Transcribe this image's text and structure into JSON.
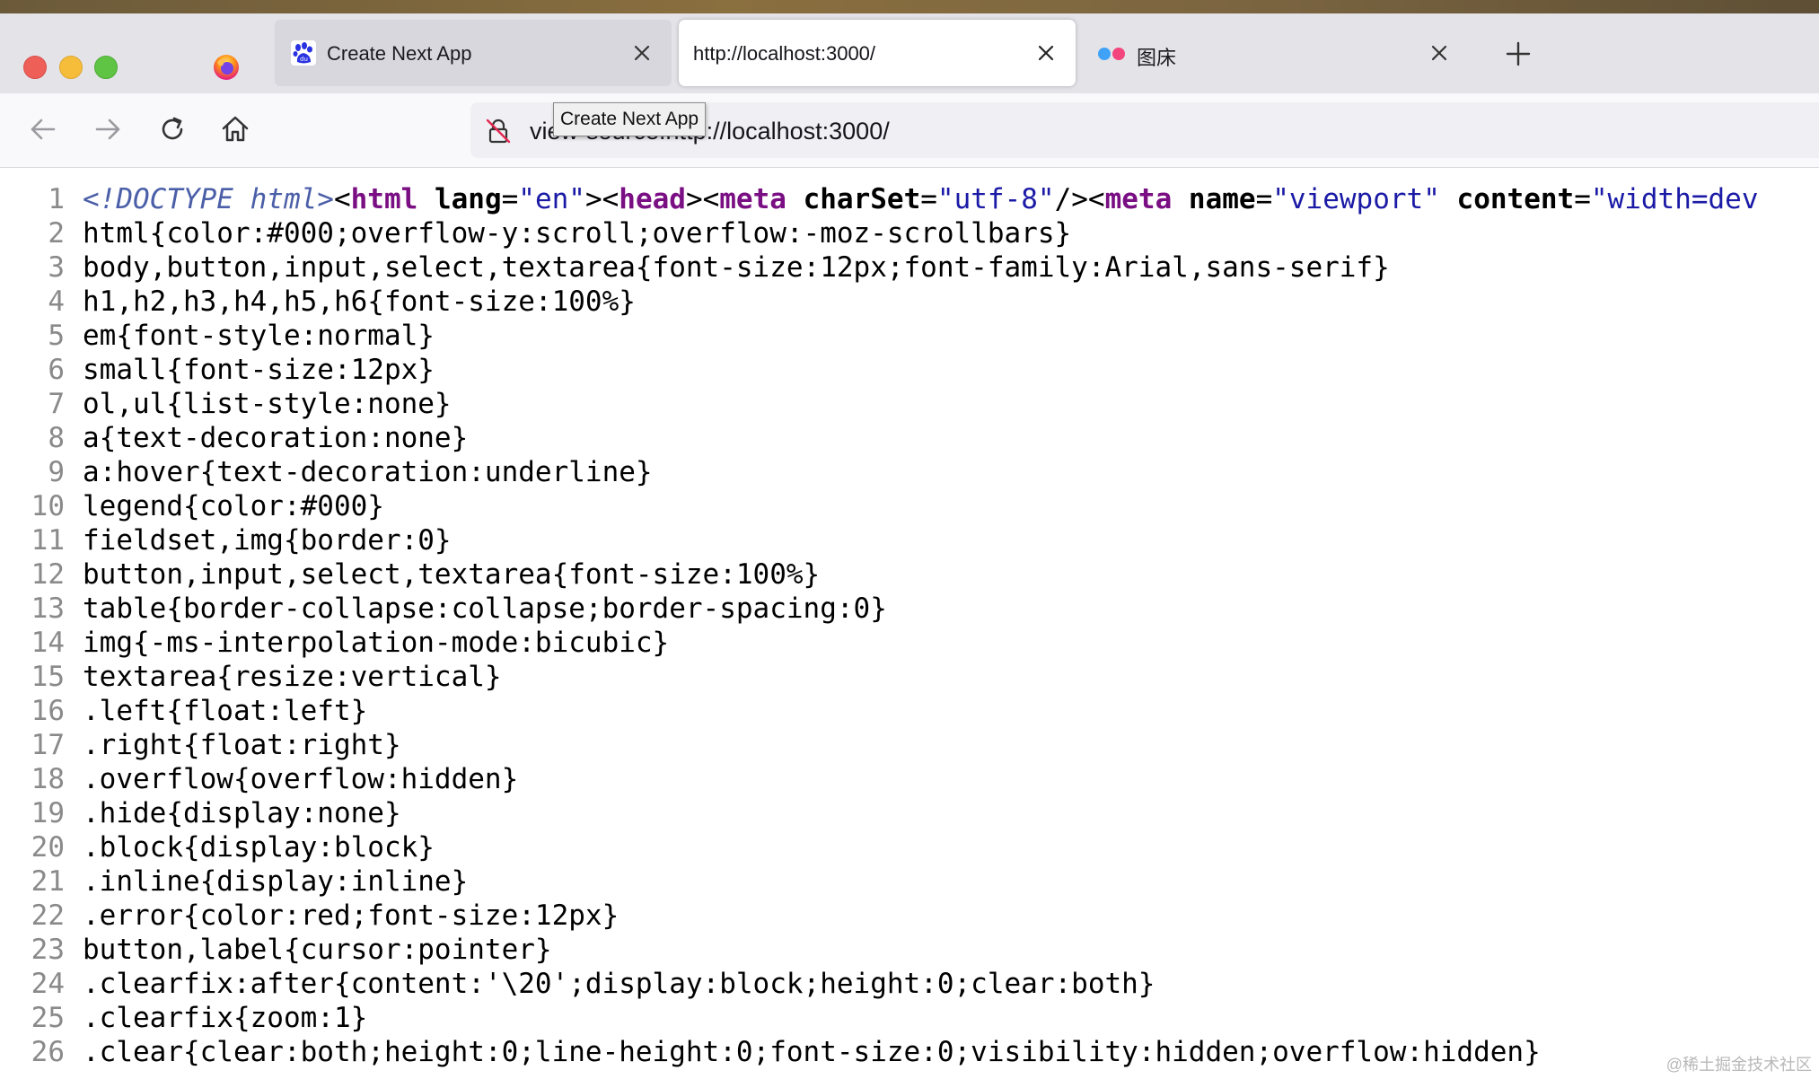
{
  "tabs": [
    {
      "title": "Create Next App",
      "favicon": "baidu-paw-icon",
      "active": false
    },
    {
      "title": "http://localhost:3000/",
      "favicon": "",
      "active": true
    },
    {
      "title": "图床",
      "favicon": "flickr-dots-icon",
      "active": false
    }
  ],
  "toolbar": {
    "url": "view-source:http://localhost:3000/",
    "tooltip": "Create Next App"
  },
  "source": {
    "line1": {
      "num": "1",
      "doctype": "<!DOCTYPE html>",
      "a": "<",
      "t1": "html",
      "a1": "lang",
      "v1": "\"en\"",
      "c1": "><",
      "t2": "head",
      "c2": "><",
      "t3": "meta",
      "a3": "charSet",
      "v3": "\"utf-8\"",
      "c3": "/><",
      "t4": "meta",
      "a4": "name",
      "v4": "\"viewport\"",
      "a5": "content",
      "v5": "\"width=dev"
    },
    "lines": [
      {
        "num": "2",
        "text": "html{color:#000;overflow-y:scroll;overflow:-moz-scrollbars}"
      },
      {
        "num": "3",
        "text": "body,button,input,select,textarea{font-size:12px;font-family:Arial,sans-serif}"
      },
      {
        "num": "4",
        "text": "h1,h2,h3,h4,h5,h6{font-size:100%}"
      },
      {
        "num": "5",
        "text": "em{font-style:normal}"
      },
      {
        "num": "6",
        "text": "small{font-size:12px}"
      },
      {
        "num": "7",
        "text": "ol,ul{list-style:none}"
      },
      {
        "num": "8",
        "text": "a{text-decoration:none}"
      },
      {
        "num": "9",
        "text": "a:hover{text-decoration:underline}"
      },
      {
        "num": "10",
        "text": "legend{color:#000}"
      },
      {
        "num": "11",
        "text": "fieldset,img{border:0}"
      },
      {
        "num": "12",
        "text": "button,input,select,textarea{font-size:100%}"
      },
      {
        "num": "13",
        "text": "table{border-collapse:collapse;border-spacing:0}"
      },
      {
        "num": "14",
        "text": "img{-ms-interpolation-mode:bicubic}"
      },
      {
        "num": "15",
        "text": "textarea{resize:vertical}"
      },
      {
        "num": "16",
        "text": ".left{float:left}"
      },
      {
        "num": "17",
        "text": ".right{float:right}"
      },
      {
        "num": "18",
        "text": ".overflow{overflow:hidden}"
      },
      {
        "num": "19",
        "text": ".hide{display:none}"
      },
      {
        "num": "20",
        "text": ".block{display:block}"
      },
      {
        "num": "21",
        "text": ".inline{display:inline}"
      },
      {
        "num": "22",
        "text": ".error{color:red;font-size:12px}"
      },
      {
        "num": "23",
        "text": "button,label{cursor:pointer}"
      },
      {
        "num": "24",
        "text": ".clearfix:after{content:'\\20';display:block;height:0;clear:both}"
      },
      {
        "num": "25",
        "text": ".clearfix{zoom:1}"
      },
      {
        "num": "26",
        "text": ".clear{clear:both;height:0;line-height:0;font-size:0;visibility:hidden;overflow:hidden}"
      }
    ]
  },
  "watermark": "@稀土掘金技术社区",
  "colors": {
    "tag": "#7a0e83",
    "value": "#1a1aa6",
    "doctype": "#4b5fa8",
    "line_number": "#8a8a8a"
  }
}
